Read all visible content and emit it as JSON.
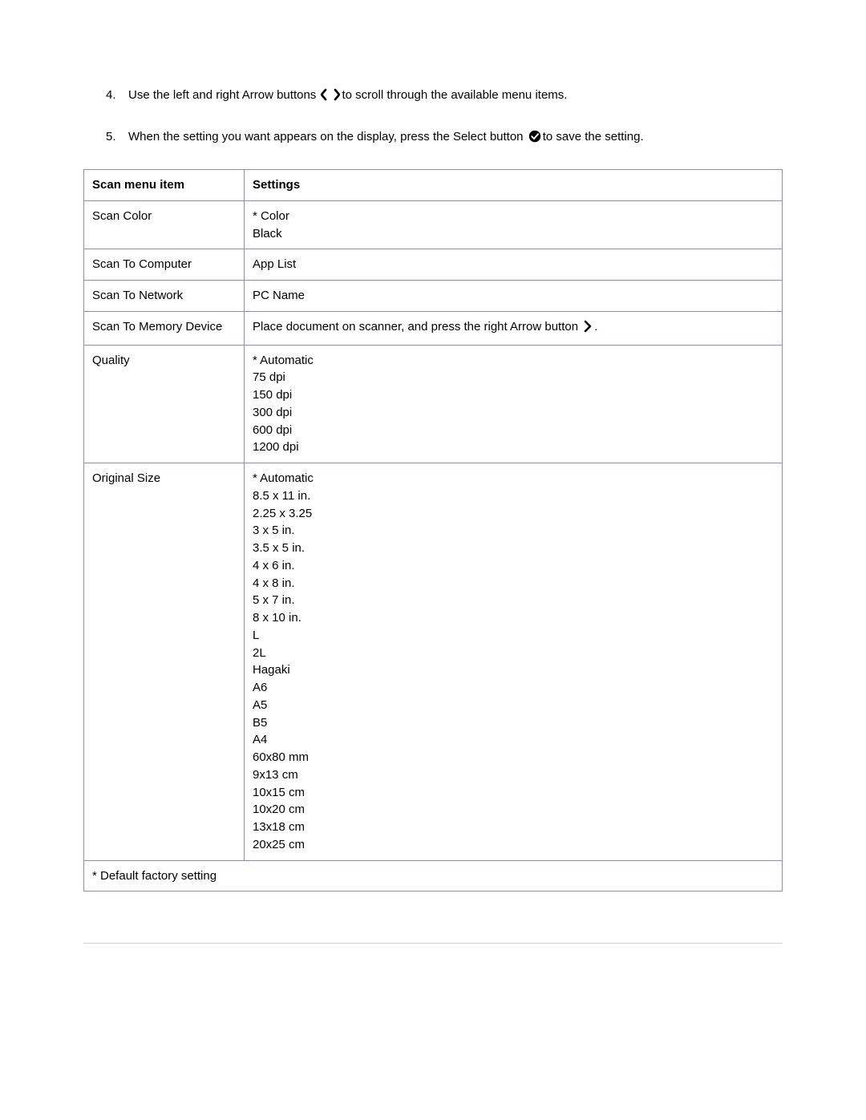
{
  "instructions": [
    {
      "num": "4.",
      "pre": "Use the left and right Arrow buttons ",
      "post": "to scroll through the available menu items."
    },
    {
      "num": "5.",
      "pre": "When the setting you want appears on the display, press the Select button ",
      "post": "to save the setting."
    }
  ],
  "table": {
    "header": {
      "col1": "Scan menu item",
      "col2": "Settings"
    },
    "rows": [
      {
        "item": "Scan Color",
        "settings": [
          "* Color",
          "Black"
        ]
      },
      {
        "item": "Scan To Computer",
        "settings": [
          "App List"
        ]
      },
      {
        "item": "Scan To Network",
        "settings": [
          "PC Name"
        ]
      },
      {
        "item": "Scan To Memory Device",
        "settings_inline": {
          "pre": "Place document on scanner, and press the right Arrow button ",
          "post": "."
        }
      },
      {
        "item": "Quality",
        "settings": [
          "* Automatic",
          "75 dpi",
          "150 dpi",
          "300 dpi",
          "600 dpi",
          "1200 dpi"
        ]
      },
      {
        "item": "Original Size",
        "settings": [
          "* Automatic",
          "8.5 x 11 in.",
          "2.25 x 3.25",
          "3 x 5 in.",
          "3.5 x 5 in.",
          "4 x 6 in.",
          "4 x 8 in.",
          "5 x 7 in.",
          "8 x 10 in.",
          "L",
          "2L",
          "Hagaki",
          "A6",
          "A5",
          "B5",
          "A4",
          "60x80 mm",
          "9x13 cm",
          "10x15 cm",
          "10x20 cm",
          "13x18 cm",
          "20x25 cm"
        ]
      }
    ],
    "footnote": "* Default factory setting"
  }
}
